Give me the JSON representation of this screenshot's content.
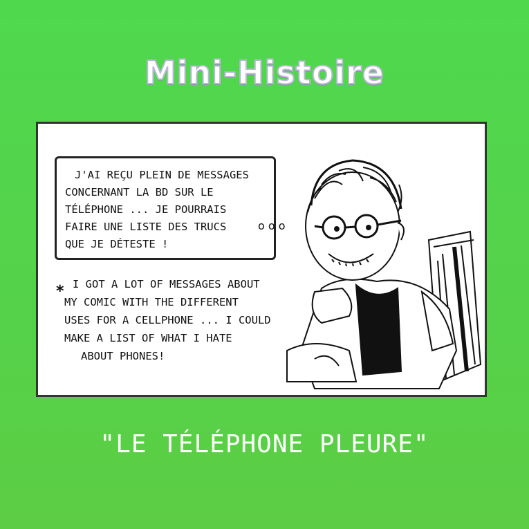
{
  "header": {
    "title": "Mini-Histoire"
  },
  "comic": {
    "speech_lines": [
      "J'ai reçu plein de messages",
      "concernant la BD sur le",
      "téléphone ... je pourrais",
      "faire une liste des trucs",
      "que je déteste !"
    ],
    "note_asterisk": "*",
    "note_lines": [
      "I got a lot of messages about",
      "my comic with the different",
      "uses for a cellphone ... I could",
      "make a list of what I hate",
      "about phones!"
    ],
    "thought_dots": "o o o"
  },
  "footer": {
    "subtitle": "\"LE TÉLÉPHONE PLEURE\""
  }
}
